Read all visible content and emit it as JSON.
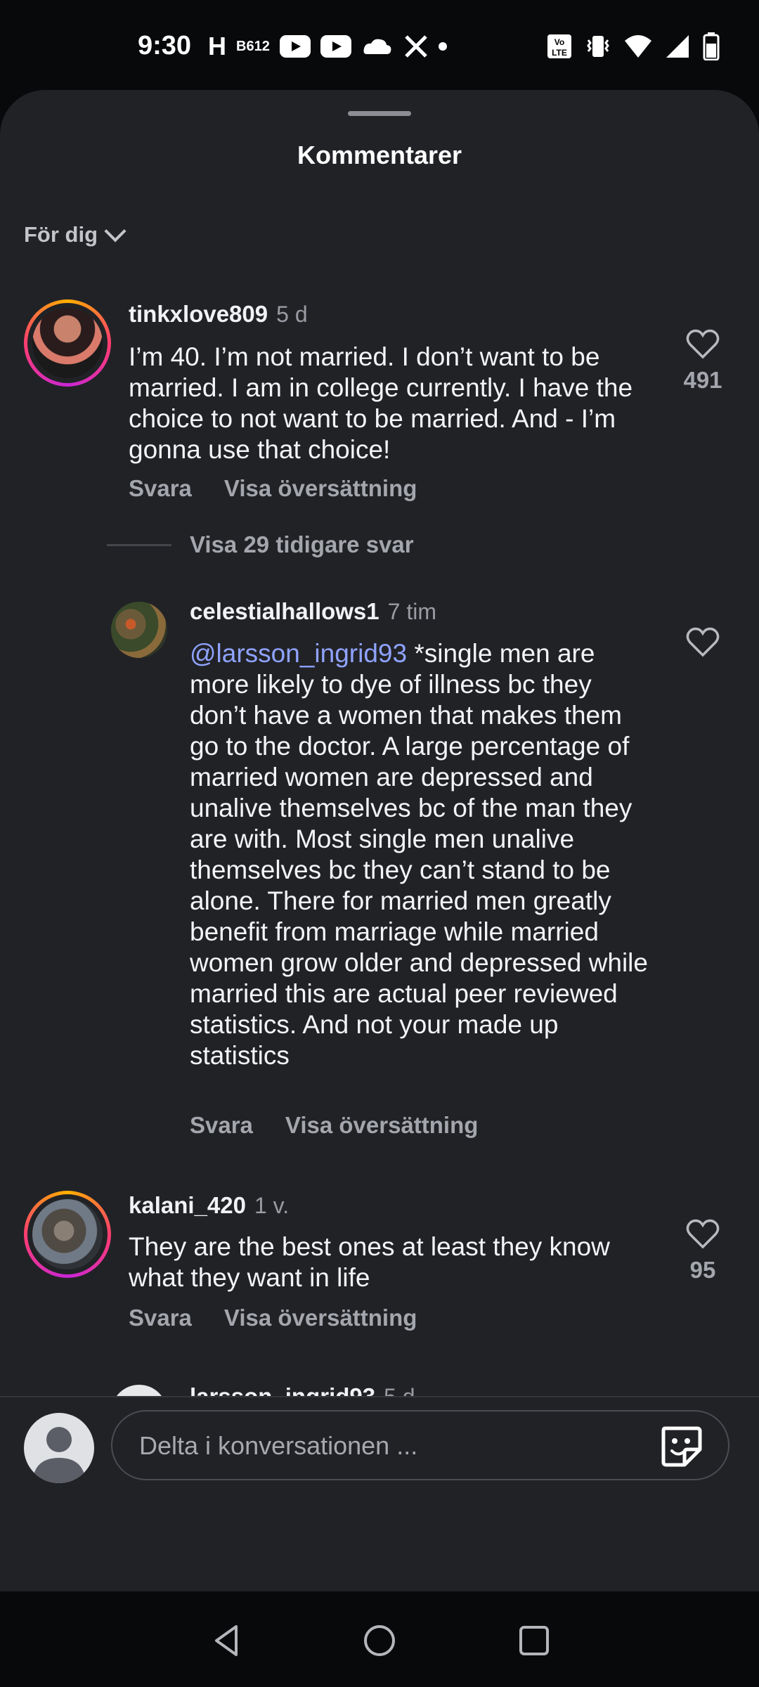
{
  "status_bar": {
    "time": "9:30",
    "left_icons": [
      "hinge-icon",
      "b612-icon",
      "youtube-icon",
      "youtube-icon",
      "klarna-icon",
      "x-icon",
      "dot-icon"
    ],
    "right_icons": [
      "volte-icon",
      "vibrate-icon",
      "wifi-icon",
      "signal-icon",
      "battery-icon"
    ]
  },
  "sheet": {
    "title": "Kommentarer",
    "filter_label": "För dig"
  },
  "comments": [
    {
      "username": "tinkxlove809",
      "age": "5 d",
      "text": "I’m 40. I’m not married. I don’t want to be married. I am in college currently. I have the choice to not want to be married. And - I’m gonna use that choice!",
      "reply_label": "Svara",
      "translate_label": "Visa översättning",
      "likes": "491"
    },
    {
      "username": "kalani_420",
      "age": "1 v.",
      "text": "They are the best ones at least they know what they want in life",
      "reply_label": "Svara",
      "translate_label": "Visa översättning",
      "likes": "95"
    }
  ],
  "show_replies": "Visa 29 tidigare svar",
  "reply": {
    "username": "celestialhallows1",
    "age": "7 tim",
    "mention": "@larsson_ingrid93",
    "text": " *single men are more likely to dye of illness bc they don’t have a women that makes them go to the doctor. A large percentage of married women are depressed and unalive themselves bc of the man they are with. Most single men unalive themselves bc they can’t stand to be alone. There for married men greatly benefit from marriage while married women grow older and depressed while married this are actual peer reviewed statistics. And not your made up statistics",
    "reply_label": "Svara",
    "translate_label": "Visa översättning"
  },
  "partial_comment": {
    "username": "larsson_ingrid93",
    "age": "5 d"
  },
  "emoji_bar": [
    "❤️",
    "🙌",
    "🔥",
    "👏",
    "😢",
    "😍",
    "😮",
    "😂"
  ],
  "compose": {
    "placeholder": "Delta i konversationen ..."
  },
  "colors": {
    "sheet_bg": "#212226",
    "mention": "#8fa3ff",
    "story_ring": "#ff3d6f"
  }
}
